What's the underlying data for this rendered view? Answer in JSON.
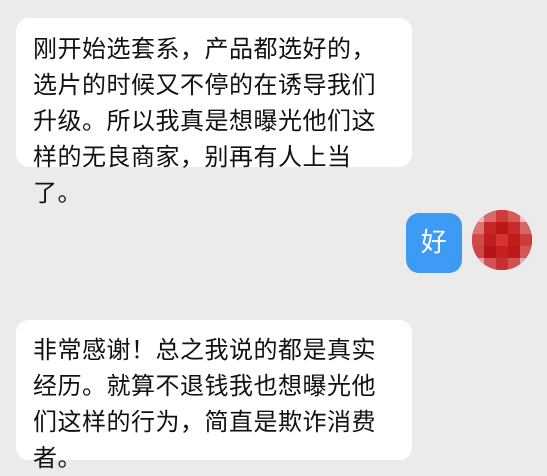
{
  "conversation": {
    "messages": [
      {
        "side": "incoming",
        "text": "刚开始选套系，产品都选好的，选片的时候又不停的在诱导我们升级。所以我真是想曝光他们这样的无良商家，别再有人上当了。"
      },
      {
        "side": "outgoing",
        "text": "好"
      },
      {
        "side": "incoming",
        "text": "非常感谢！总之我说的都是真实经历。就算不退钱我也想曝光他们这样的行为，简直是欺诈消费者。"
      }
    ]
  },
  "user": {
    "avatar_icon": "pixelated-avatar-icon"
  },
  "theme": {
    "background": "#ebebeb",
    "incoming_bubble": "#ffffff",
    "outgoing_bubble": "#3d9af5",
    "avatar_red": "#c41d1d"
  }
}
